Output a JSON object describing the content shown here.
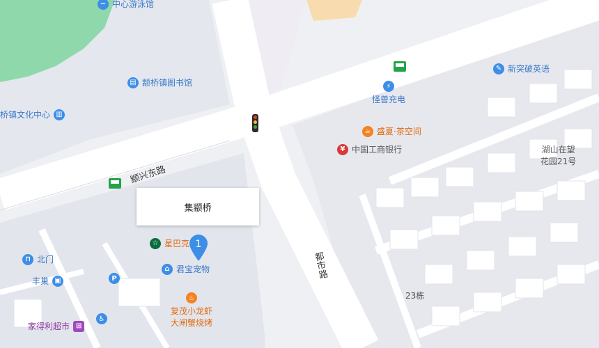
{
  "map": {
    "popup_title": "集颛桥",
    "marker_number": "1",
    "roads": {
      "dianxing_east": "颛兴东路",
      "dushi": "都市路"
    },
    "pois": {
      "swimming_pool": "中心游泳馆",
      "library": "颛桥镇图书馆",
      "culture_center": "桥镇文化中心",
      "xintupo": "新突破英语",
      "guaishou": "怪兽充电",
      "shengxia": "盛夏·茶空间",
      "icbc": "中国工商银行",
      "hushan": "湖山在望\n花园21号",
      "starbucks": "星巴克",
      "junbao": "君宝宠物",
      "beimen": "北门",
      "fengchao": "丰巢",
      "fumao": "复茂小龙虾\n大闸蟹烧烤",
      "jiadeli": "家得利超市",
      "building23": "23栋"
    }
  }
}
